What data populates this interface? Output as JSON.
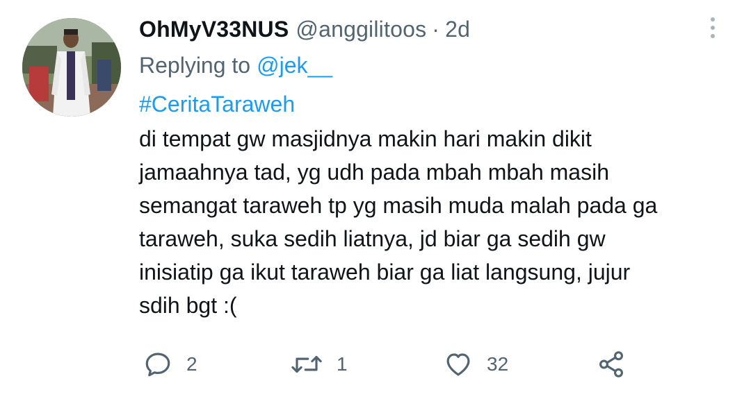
{
  "tweet": {
    "display_name": "OhMyV33NUS",
    "handle": "@anggilitoos",
    "separator": "·",
    "time": "2d",
    "replying_prefix": "Replying to",
    "replying_to": "@jek__",
    "hashtag": "#CeritaTaraweh",
    "body_lines": [
      "di tempat gw masjidnya makin hari makin dikit",
      "jamaahnya tad, yg udh pada mbah mbah masih",
      "semangat taraweh tp yg masih muda malah pada ga",
      "taraweh, suka sedih liatnya, jd biar ga sedih gw",
      "inisiatip ga ikut taraweh biar ga liat langsung, jujur",
      "sdih bgt :("
    ]
  },
  "actions": {
    "reply": {
      "icon": "reply-icon",
      "count": "2"
    },
    "retweet": {
      "icon": "retweet-icon",
      "count": "1"
    },
    "like": {
      "icon": "heart-icon",
      "count": "32"
    },
    "share": {
      "icon": "share-icon"
    }
  },
  "colors": {
    "text": "#0f1419",
    "secondary": "#536471",
    "accent": "#1d9bf0",
    "background": "#ffffff"
  }
}
